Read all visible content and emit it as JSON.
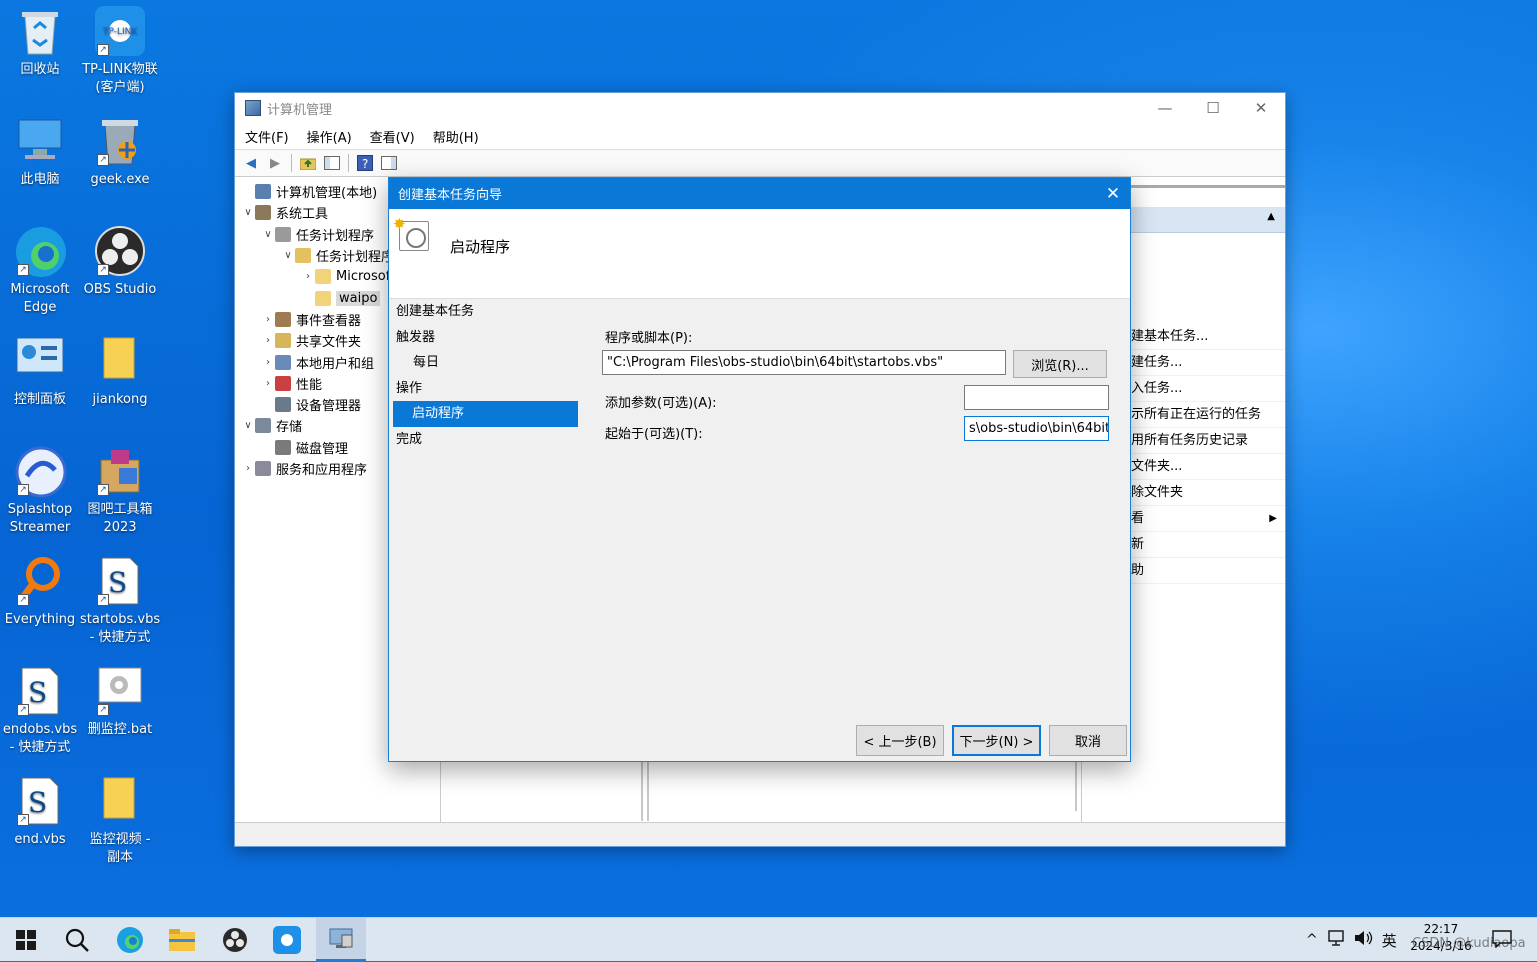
{
  "desktop_icons": [
    {
      "id": "recycle",
      "label1": "回收站",
      "label2": ""
    },
    {
      "id": "tplink",
      "label1": "TP-LINK物联",
      "label2": "(客户端)"
    },
    {
      "id": "thispc",
      "label1": "此电脑",
      "label2": ""
    },
    {
      "id": "geek",
      "label1": "geek.exe",
      "label2": ""
    },
    {
      "id": "edge",
      "label1": "Microsoft",
      "label2": "Edge"
    },
    {
      "id": "obs",
      "label1": "OBS Studio",
      "label2": ""
    },
    {
      "id": "control",
      "label1": "控制面板",
      "label2": ""
    },
    {
      "id": "jiankong",
      "label1": "jiankong",
      "label2": ""
    },
    {
      "id": "splashtop",
      "label1": "Splashtop",
      "label2": "Streamer"
    },
    {
      "id": "tuba",
      "label1": "图吧工具箱",
      "label2": "2023"
    },
    {
      "id": "everything",
      "label1": "Everything",
      "label2": ""
    },
    {
      "id": "startobs",
      "label1": "startobs.vbs",
      "label2": "- 快捷方式"
    },
    {
      "id": "endobs",
      "label1": "endobs.vbs",
      "label2": "- 快捷方式"
    },
    {
      "id": "shanjiankong",
      "label1": "删监控.bat",
      "label2": ""
    },
    {
      "id": "endvbs",
      "label1": "end.vbs",
      "label2": ""
    },
    {
      "id": "jiankongvideo",
      "label1": "监控视频 -",
      "label2": "副本"
    }
  ],
  "window": {
    "title": "计算机管理",
    "minimize": "—",
    "maximize": "☐",
    "close": "✕"
  },
  "menu": [
    "文件(F)",
    "操作(A)",
    "查看(V)",
    "帮助(H)"
  ],
  "tree": [
    {
      "label": "计算机管理(本地)",
      "arrow": "",
      "indent": 0,
      "color": "#5a7fae"
    },
    {
      "label": "系统工具",
      "arrow": "∨",
      "indent": 0,
      "color": "#8a7a5a"
    },
    {
      "label": "任务计划程序",
      "arrow": "∨",
      "indent": 1,
      "color": "#9a9a9a"
    },
    {
      "label": "任务计划程序库",
      "arrow": "∨",
      "indent": 2,
      "color": "#e6c060"
    },
    {
      "label": "Microsoft",
      "arrow": "›",
      "indent": 3,
      "color": "#f2d27a"
    },
    {
      "label": "waipo",
      "arrow": "",
      "indent": 3,
      "color": "#f2d27a",
      "selected": true
    },
    {
      "label": "事件查看器",
      "arrow": "›",
      "indent": 1,
      "color": "#a07a50"
    },
    {
      "label": "共享文件夹",
      "arrow": "›",
      "indent": 1,
      "color": "#d8b45a"
    },
    {
      "label": "本地用户和组",
      "arrow": "›",
      "indent": 1,
      "color": "#6a8ab8"
    },
    {
      "label": "性能",
      "arrow": "›",
      "indent": 1,
      "color": "#c84040"
    },
    {
      "label": "设备管理器",
      "arrow": "",
      "indent": 1,
      "color": "#6a7a8a"
    },
    {
      "label": "存储",
      "arrow": "∨",
      "indent": 0,
      "color": "#7a8a9a"
    },
    {
      "label": "磁盘管理",
      "arrow": "",
      "indent": 1,
      "color": "#7a7a7a"
    },
    {
      "label": "服务和应用程序",
      "arrow": "›",
      "indent": 0,
      "color": "#8a8a9a"
    }
  ],
  "actions": {
    "collapse_icon": "▲",
    "items": [
      "建基本任务...",
      "建任务...",
      "入任务...",
      "示所有正在运行的任务",
      "用所有任务历史记录",
      "文件夹...",
      "除文件夹",
      "看",
      "新",
      "助"
    ]
  },
  "dialog": {
    "title": "创建基本任务向导",
    "close": "✕",
    "header": "启动程序",
    "steps": [
      {
        "label": "创建基本任务",
        "sub": false,
        "active": false
      },
      {
        "label": "触发器",
        "sub": false,
        "active": false
      },
      {
        "label": "每日",
        "sub": true,
        "active": false
      },
      {
        "label": "操作",
        "sub": false,
        "active": false
      },
      {
        "label": "启动程序",
        "sub": true,
        "active": true
      },
      {
        "label": "完成",
        "sub": false,
        "active": false
      }
    ],
    "program_label": "程序或脚本(P):",
    "program_value": "\"C:\\Program Files\\obs-studio\\bin\\64bit\\startobs.vbs\"",
    "browse": "浏览(R)...",
    "args_label": "添加参数(可选)(A):",
    "args_value": "",
    "startin_label": "起始于(可选)(T):",
    "startin_value": "s\\obs-studio\\bin\\64bit",
    "back": "< 上一步(B)",
    "next": "下一步(N) >",
    "cancel": "取消"
  },
  "taskbar": {
    "tray_chevron": "^",
    "ime": "英",
    "time": "22:17",
    "date": "2024/3/16",
    "watermark": "CSDN @kudiaopa"
  }
}
